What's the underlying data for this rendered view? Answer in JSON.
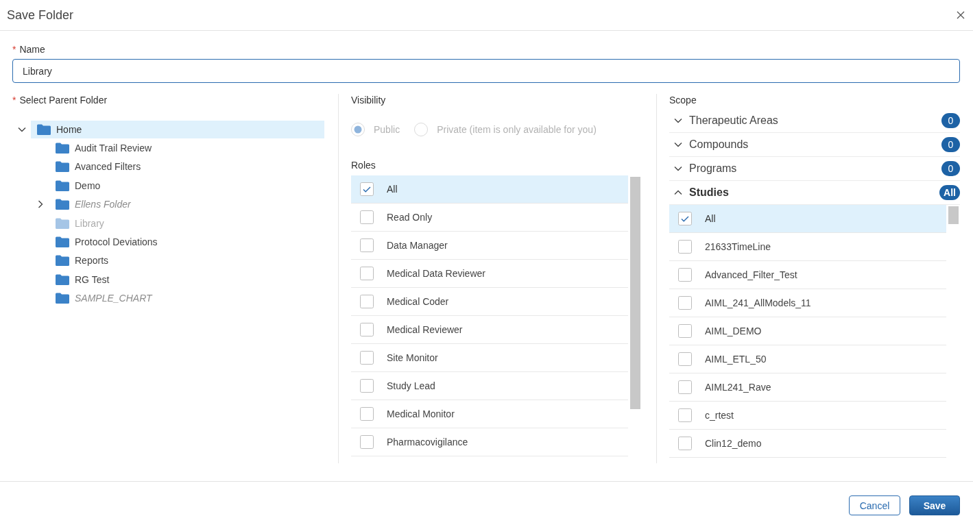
{
  "dialog": {
    "title": "Save Folder"
  },
  "name_field": {
    "required_mark": "*",
    "label": "Name",
    "value": "Library"
  },
  "parent_folder": {
    "required_mark": "*",
    "label": "Select Parent Folder",
    "tree": [
      {
        "label": "Home",
        "selected": true,
        "expanded": true,
        "italic": false,
        "disabled": false,
        "children": [
          {
            "label": "Audit Trail Review",
            "selected": false,
            "italic": false,
            "disabled": false
          },
          {
            "label": "Avanced Filters",
            "selected": false,
            "italic": false,
            "disabled": false
          },
          {
            "label": "Demo",
            "selected": false,
            "italic": false,
            "disabled": false
          },
          {
            "label": "Ellens Folder",
            "selected": false,
            "expanded": false,
            "italic": true,
            "disabled": false
          },
          {
            "label": "Library",
            "selected": false,
            "italic": false,
            "disabled": true
          },
          {
            "label": "Protocol Deviations",
            "selected": false,
            "italic": false,
            "disabled": false
          },
          {
            "label": "Reports",
            "selected": false,
            "italic": false,
            "disabled": false
          },
          {
            "label": "RG Test",
            "selected": false,
            "italic": false,
            "disabled": false
          },
          {
            "label": "SAMPLE_CHART",
            "selected": false,
            "italic": true,
            "disabled": false
          }
        ]
      }
    ]
  },
  "visibility": {
    "label": "Visibility",
    "disabled": true,
    "options": [
      {
        "label": "Public",
        "selected": true
      },
      {
        "label": "Private (item is only available for you)",
        "selected": false
      }
    ]
  },
  "roles": {
    "label": "Roles",
    "items": [
      {
        "label": "All",
        "checked": true
      },
      {
        "label": "Read Only",
        "checked": false
      },
      {
        "label": "Data Manager",
        "checked": false
      },
      {
        "label": "Medical Data Reviewer",
        "checked": false
      },
      {
        "label": "Medical Coder",
        "checked": false
      },
      {
        "label": "Medical Reviewer",
        "checked": false
      },
      {
        "label": "Site Monitor",
        "checked": false
      },
      {
        "label": "Study Lead",
        "checked": false
      },
      {
        "label": "Medical Monitor",
        "checked": false
      },
      {
        "label": "Pharmacovigilance",
        "checked": false
      }
    ]
  },
  "scope": {
    "label": "Scope",
    "sections": [
      {
        "label": "Therapeutic Areas",
        "expanded": false,
        "badge": "0"
      },
      {
        "label": "Compounds",
        "expanded": false,
        "badge": "0"
      },
      {
        "label": "Programs",
        "expanded": false,
        "badge": "0"
      },
      {
        "label": "Studies",
        "expanded": true,
        "badge": "All",
        "items": [
          {
            "label": "All",
            "checked": true
          },
          {
            "label": "21633TimeLine",
            "checked": false
          },
          {
            "label": "Advanced_Filter_Test",
            "checked": false
          },
          {
            "label": "AIML_241_AllModels_11",
            "checked": false
          },
          {
            "label": "AIML_DEMO",
            "checked": false
          },
          {
            "label": "AIML_ETL_50",
            "checked": false
          },
          {
            "label": "AIML241_Rave",
            "checked": false
          },
          {
            "label": "c_rtest",
            "checked": false
          },
          {
            "label": "Clin12_demo",
            "checked": false
          }
        ]
      }
    ]
  },
  "buttons": [
    {
      "label": "Cancel",
      "kind": "secondary"
    },
    {
      "label": "Save",
      "kind": "primary"
    }
  ]
}
